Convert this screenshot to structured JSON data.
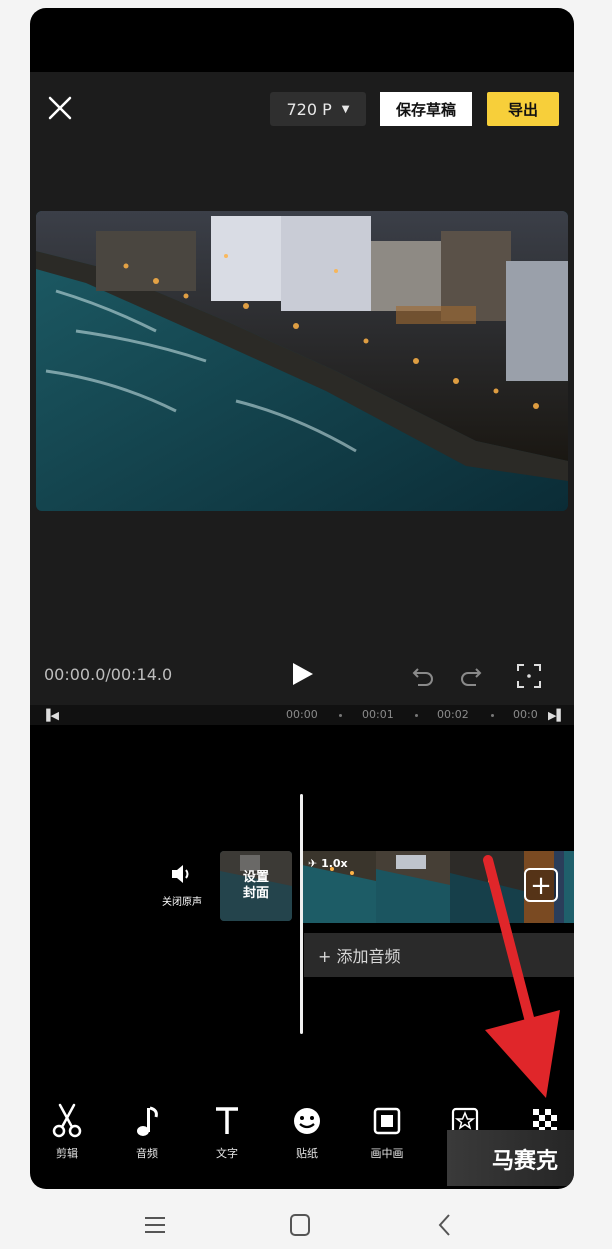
{
  "header": {
    "resolution": "720 P",
    "save_draft": "保存草稿",
    "export": "导出"
  },
  "player": {
    "timecode": "00:00.0/00:14.0"
  },
  "ruler": {
    "ticks": [
      "00:00",
      "00:01",
      "00:02",
      "00:0"
    ]
  },
  "track": {
    "mute_label": "关闭原声",
    "cover_label": "设置\n封面",
    "speed_badge": "1.0x",
    "add_audio": "+ 添加音频"
  },
  "toolbar": {
    "items": [
      {
        "label": "剪辑",
        "icon": "scissors-icon"
      },
      {
        "label": "音频",
        "icon": "music-note-icon"
      },
      {
        "label": "文字",
        "icon": "text-icon"
      },
      {
        "label": "贴纸",
        "icon": "sticker-icon"
      },
      {
        "label": "画中画",
        "icon": "picture-in-picture-icon"
      },
      {
        "label": "",
        "icon": "star-icon"
      },
      {
        "label": "马赛克",
        "icon": "mosaic-icon"
      }
    ]
  },
  "colors": {
    "accent_export": "#f7cf3a",
    "arrow": "#e0262a",
    "background": "#000000",
    "panel": "#1c1c1c"
  }
}
